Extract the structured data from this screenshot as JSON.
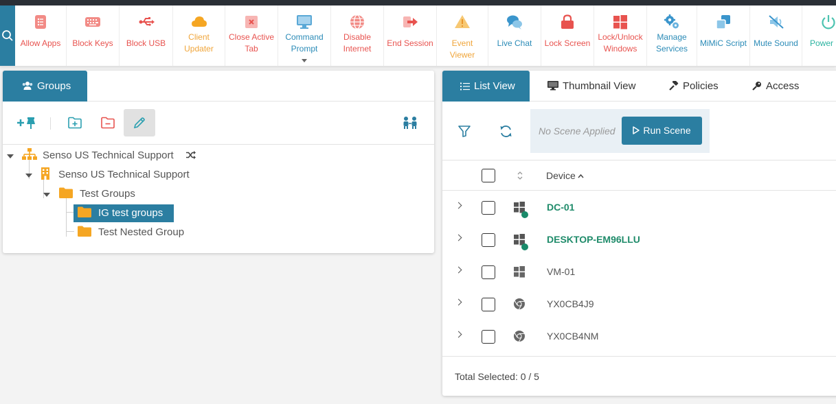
{
  "toolbar": {
    "items": [
      {
        "label": "Allow Apps",
        "icon": "list-icon",
        "color": "#e8534f"
      },
      {
        "label": "Block Keys",
        "icon": "keyboard-icon",
        "color": "#e8534f"
      },
      {
        "label": "Block USB",
        "icon": "usb-icon",
        "color": "#e8534f"
      },
      {
        "label": "Client\nUpdater",
        "icon": "cloud-icon",
        "color": "#f0a53a"
      },
      {
        "label": "Close Active\nTab",
        "icon": "close-tab-icon",
        "color": "#e8534f"
      },
      {
        "label": "Command\nPrompt",
        "icon": "monitor-icon",
        "color": "#2b8bb7"
      },
      {
        "label": "Disable\nInternet",
        "icon": "globe-icon",
        "color": "#e8534f"
      },
      {
        "label": "End Session",
        "icon": "sign-out-icon",
        "color": "#e8534f"
      },
      {
        "label": "Event Viewer",
        "icon": "warning-icon",
        "color": "#f0a53a"
      },
      {
        "label": "Live Chat",
        "icon": "chat-icon",
        "color": "#2b8bb7"
      },
      {
        "label": "Lock Screen",
        "icon": "lock-icon",
        "color": "#e8534f"
      },
      {
        "label": "Lock/Unlock\nWindows",
        "icon": "windows-icon",
        "color": "#e8534f"
      },
      {
        "label": "Manage\nServices",
        "icon": "gears-icon",
        "color": "#2b8bb7"
      },
      {
        "label": "MiMiC Script",
        "icon": "clone-icon",
        "color": "#2b8bb7"
      },
      {
        "label": "Mute Sound",
        "icon": "mute-icon",
        "color": "#2b8bb7"
      },
      {
        "label": "Power O",
        "icon": "power-icon",
        "color": "#2bb3a0"
      }
    ]
  },
  "groups": {
    "tab_label": "Groups",
    "tree": [
      {
        "label": "Senso US Technical Support",
        "icon": "sitemap-icon"
      },
      {
        "label": "Senso US Technical Support",
        "icon": "building-icon"
      },
      {
        "label": "Test Groups",
        "icon": "folder-icon"
      },
      {
        "label": "IG test groups",
        "icon": "folder-icon",
        "selected": true
      },
      {
        "label": "Test Nested Group",
        "icon": "folder-icon"
      }
    ]
  },
  "devices_panel": {
    "tabs": [
      {
        "label": "List View",
        "icon": "list-view-icon",
        "active": true
      },
      {
        "label": "Thumbnail View",
        "icon": "monitor-icon"
      },
      {
        "label": "Policies",
        "icon": "gavel-icon"
      },
      {
        "label": "Access",
        "icon": "key-icon"
      }
    ],
    "scene_status": "No Scene Applied",
    "run_scene_label": "Run Scene",
    "column_device": "Device",
    "sort_arrow": "^",
    "devices": [
      {
        "name": "DC-01",
        "os": "windows",
        "online": true
      },
      {
        "name": "DESKTOP-EM96LLU",
        "os": "windows",
        "online": true
      },
      {
        "name": "VM-01",
        "os": "windows",
        "online": false
      },
      {
        "name": "YX0CB4J9",
        "os": "chrome",
        "online": false
      },
      {
        "name": "YX0CB4NM",
        "os": "chrome",
        "online": false
      }
    ],
    "footer": "Total Selected: 0 / 5"
  },
  "colors": {
    "accent": "#2b7ea1",
    "online_text": "#1f8b6a",
    "red": "#e8534f",
    "orange": "#f0a53a",
    "folder": "#f5a623"
  }
}
